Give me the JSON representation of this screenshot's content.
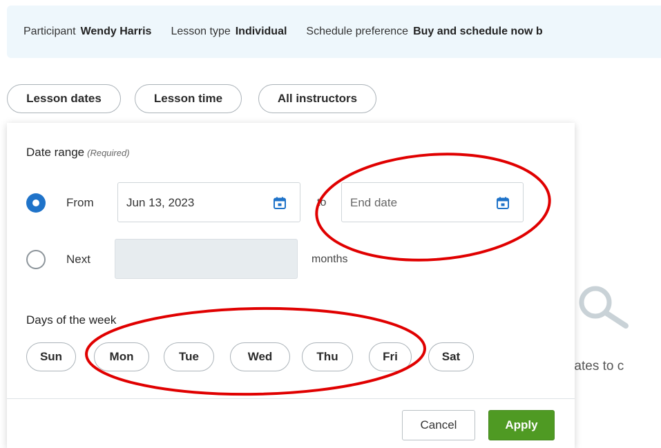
{
  "infobar": {
    "participant_label": "Participant",
    "participant_value": "Wendy Harris",
    "lesson_type_label": "Lesson type",
    "lesson_type_value": "Individual",
    "schedule_label": "Schedule preference",
    "schedule_value": "Buy and schedule now b"
  },
  "filters": {
    "lesson_dates": "Lesson dates",
    "lesson_time": "Lesson time",
    "all_instructors": "All instructors"
  },
  "panel": {
    "date_range_title": "Date range",
    "required_label": "(Required)",
    "from_label": "From",
    "from_value": "Jun 13, 2023",
    "to_label": "to",
    "end_date_placeholder": "End date",
    "next_label": "Next",
    "months_value": "",
    "months_label": "months",
    "days_title": "Days of the week",
    "days": [
      "Sun",
      "Mon",
      "Tue",
      "Wed",
      "Thu",
      "Fri",
      "Sat"
    ],
    "from_selected": true,
    "cancel_label": "Cancel",
    "apply_label": "Apply"
  },
  "background": {
    "empty_state_text": "d dates to c"
  },
  "colors": {
    "accent_blue": "#1f73c9",
    "apply_green": "#4f9a23",
    "info_bg": "#eef7fc",
    "annotation_red": "#e00000"
  },
  "icons": {
    "calendar": "calendar-icon",
    "search": "search-icon"
  }
}
